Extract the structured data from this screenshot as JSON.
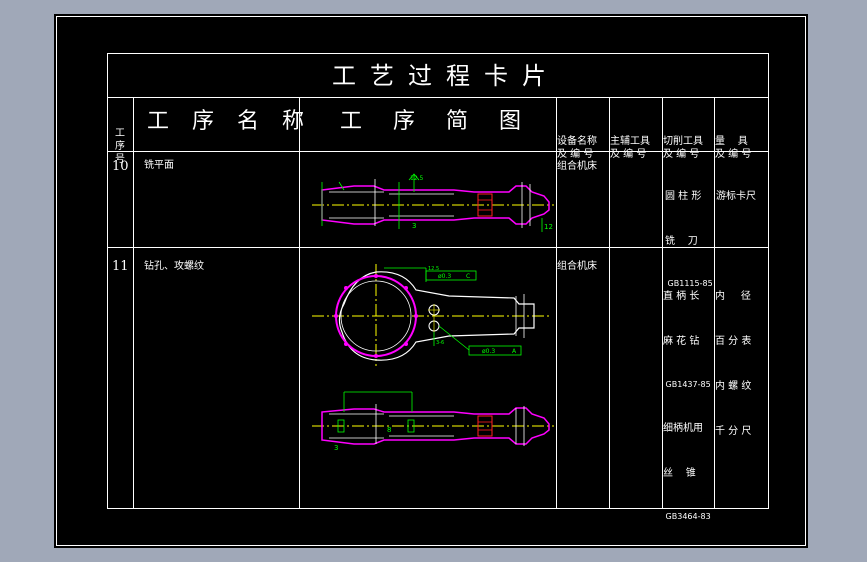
{
  "card": {
    "title": "工艺过程卡片",
    "headers": {
      "seq": [
        "工",
        "序",
        "号"
      ],
      "name": "工 序 名 称",
      "sketch": "工 序 简 图",
      "equipment": [
        "设备名称",
        "及 编 号"
      ],
      "aux_tool": [
        "主辅工具",
        "及 编 号"
      ],
      "cutting_tool": [
        "切削工具",
        "及 编 号"
      ],
      "gauge": [
        "量    具",
        "及 编 号"
      ]
    },
    "rows": [
      {
        "seq": "10",
        "name": "铣平面",
        "equipment": "组合机床",
        "aux_tool": "",
        "cutting_tool": [
          "圆 柱 形",
          "铣    刀",
          " GB1115-85"
        ],
        "gauge": [
          "游标卡尺"
        ]
      },
      {
        "seq": "11",
        "name": "钻孔、攻螺纹",
        "equipment": "组合机床",
        "aux_tool": "",
        "cutting_tool": [
          "直 柄 长",
          "麻 花 钻",
          " GB1437-85",
          "细柄机用",
          "丝    锥",
          " GB3464-83"
        ],
        "gauge": [
          "内     径",
          "百 分 表",
          "内 螺 纹",
          "千 分 尺"
        ]
      }
    ],
    "drawing_annotations": {
      "row10": [
        "12.5",
        "3",
        "12"
      ],
      "row11_top": [
        "12.5",
        "ø0.3",
        "C",
        "ø0.3",
        "A",
        "3-6"
      ],
      "row11_bottom": [
        "3",
        "8"
      ]
    }
  },
  "colors": {
    "background": "#000000",
    "outer": "#a0a8b8",
    "lines": "#ffffff",
    "part": "#ff00ff",
    "dimension": "#00ff00",
    "centerline": "#ffff00",
    "hatch": "#ff2020"
  }
}
